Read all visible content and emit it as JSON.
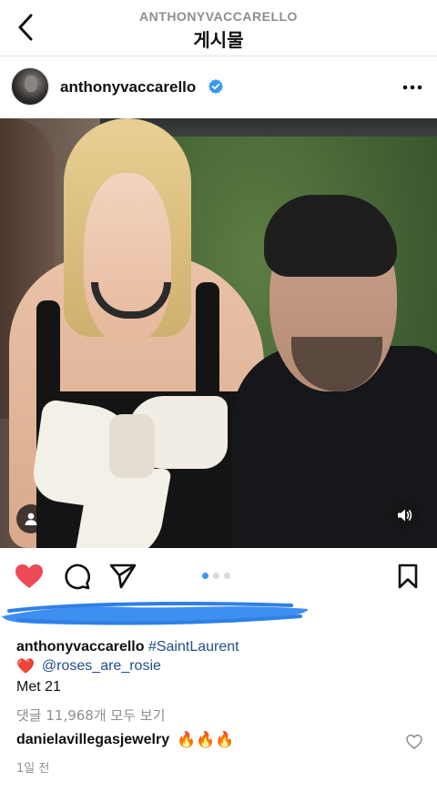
{
  "header": {
    "account_caps": "ANTHONYVACCARELLO",
    "title": "게시물"
  },
  "post": {
    "username": "anthonyvaccarello",
    "verified": true,
    "pagination": {
      "count": 3,
      "active": 1
    }
  },
  "caption": {
    "username": "anthonyvaccarello",
    "hashtag": "#SaintLaurent",
    "heart_emoji": "❤️",
    "mention": "@roses_are_rosie",
    "text": "Met 21"
  },
  "comments": {
    "view_all": "댓글 11,968개 모두 보기",
    "preview": {
      "username": "danielavillegasjewelry",
      "emojis": "🔥🔥🔥"
    }
  },
  "timestamp": "1일 전",
  "colors": {
    "like_red": "#ed4956",
    "link_blue": "#1f4f8a",
    "active_dot": "#3897f0",
    "redaction": "#3d8ff0"
  },
  "icons": [
    "back-chevron-icon",
    "verified-badge-icon",
    "more-options-icon",
    "tag-user-icon",
    "sound-icon",
    "heart-filled-icon",
    "comment-icon",
    "share-icon",
    "bookmark-icon",
    "heart-outline-icon"
  ]
}
